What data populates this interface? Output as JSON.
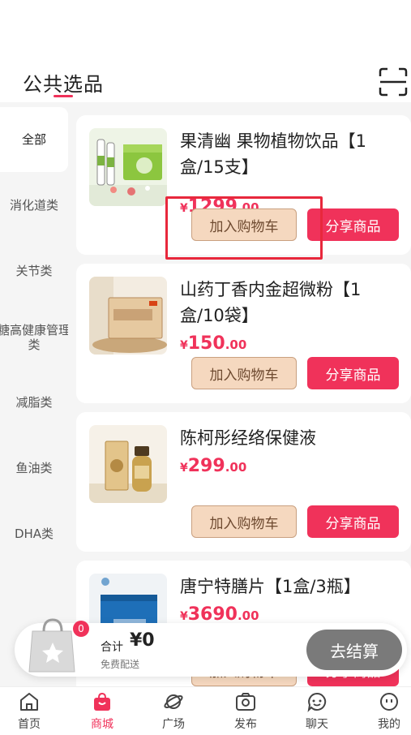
{
  "header": {
    "title": "公共选品"
  },
  "sidebar": {
    "items": [
      {
        "label": "全部"
      },
      {
        "label": "消化道类"
      },
      {
        "label": "关节类"
      },
      {
        "label": "糖高健康管理类"
      },
      {
        "label": "减脂类"
      },
      {
        "label": "鱼油类"
      },
      {
        "label": "DHA类"
      }
    ]
  },
  "products": [
    {
      "name": "果清幽 果物植物饮品【1盒/15支】",
      "price_symbol": "¥",
      "price_int": "1299",
      "price_dec": ".00",
      "cart_label": "加入购物车",
      "share_label": "分享商品"
    },
    {
      "name": "山药丁香内金超微粉【1盒/10袋】",
      "price_symbol": "¥",
      "price_int": "150",
      "price_dec": ".00",
      "cart_label": "加入购物车",
      "share_label": "分享商品"
    },
    {
      "name": "陈柯彤经络保健液",
      "price_symbol": "¥",
      "price_int": "299",
      "price_dec": ".00",
      "cart_label": "加入购物车",
      "share_label": "分享商品"
    },
    {
      "name": "唐宁特膳片【1盒/3瓶】",
      "price_symbol": "¥",
      "price_int": "3690",
      "price_dec": ".00",
      "cart_label": "加入购物车",
      "share_label": "分享商品"
    }
  ],
  "cart": {
    "badge": "0",
    "total_label": "合计",
    "total_amount": "¥0",
    "shipping": "免费配送",
    "checkout_label": "去结算"
  },
  "tabbar": {
    "items": [
      {
        "label": "首页",
        "icon": "home-icon"
      },
      {
        "label": "商城",
        "icon": "shop-bag-icon"
      },
      {
        "label": "广场",
        "icon": "planet-icon"
      },
      {
        "label": "发布",
        "icon": "camera-icon"
      },
      {
        "label": "聊天",
        "icon": "chat-icon"
      },
      {
        "label": "我的",
        "icon": "face-icon"
      }
    ],
    "active_index": 1
  },
  "colors": {
    "accent": "#f0325a",
    "cart_button": "#f5d8bf",
    "checkout_disabled": "#7a7a7a"
  }
}
